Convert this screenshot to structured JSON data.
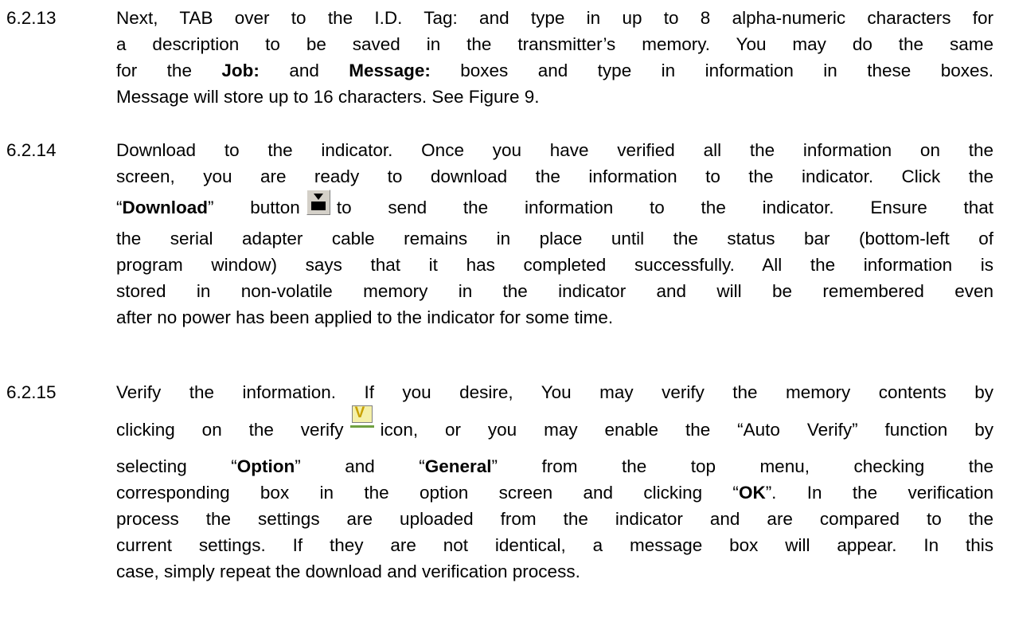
{
  "sections": [
    {
      "number": "6.2.13",
      "lines": [
        "Next, TAB over to the I.D. Tag: and type in up to 8 alpha-numeric characters for",
        "a description to be saved in the transmitter’s memory.  You may do the same",
        {
          "pre": "for the ",
          "b1": "Job:",
          "mid": " and ",
          "b2": "Message:",
          "post": " boxes and type in information in these boxes."
        },
        "Message will store up to 16 characters.  See Figure 9."
      ]
    },
    {
      "number": "6.2.14",
      "lines": [
        "Download to the indicator.  Once you have verified all the information on the",
        "screen, you are ready to download the information to the indicator.  Click the",
        {
          "q1": "“",
          "b": "Download",
          "q2": "” button",
          "post": "to send the information to the indicator.  Ensure that"
        },
        "the serial adapter cable remains in place until the status bar (bottom-left of",
        "program window) says that it has completed successfully.  All the information is",
        "stored in non-volatile memory in the indicator and will be remembered even",
        "after no power has been applied to the indicator for some time."
      ],
      "download_icon": "download-icon"
    },
    {
      "number": "6.2.15",
      "lines": [
        "Verify the information.   If you desire, You may verify the memory contents by",
        {
          "pre": "clicking on the verify",
          "post": "icon, or you may enable the “Auto Verify” function by"
        },
        {
          "pre": "selecting “",
          "b1": "Option",
          "mid": "” and “",
          "b2": "General",
          "post": "” from the top menu, checking the"
        },
        "corresponding box in the option screen and clicking “",
        "process the settings are uploaded from the indicator and are compared to the",
        "current settings. If they are not identical, a message box will appear.  In this",
        "case, simply repeat the download and verification process."
      ],
      "ok_bold": "OK",
      "ok_after": "”. In the verification",
      "verify_icon": "verify-icon"
    }
  ]
}
